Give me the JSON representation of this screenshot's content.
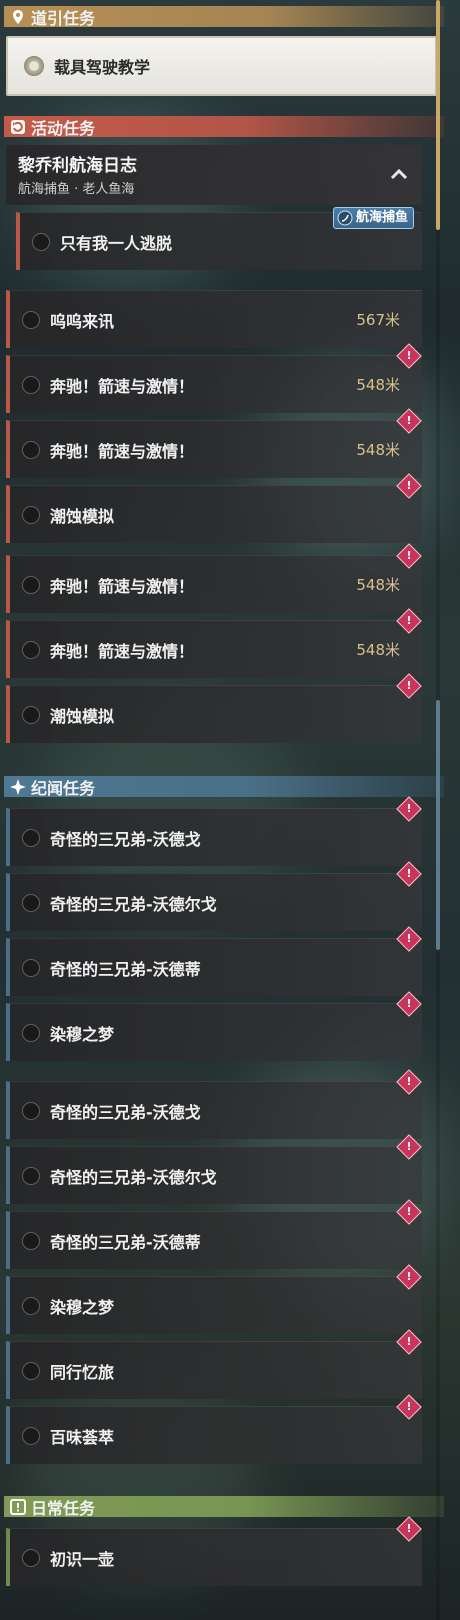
{
  "sections": {
    "guide": {
      "label": "道引任务"
    },
    "event": {
      "label": "活动任务"
    },
    "lore": {
      "label": "纪闻任务"
    },
    "daily": {
      "label": "日常任务"
    }
  },
  "guide_task": {
    "title": "载具驾驶教学"
  },
  "quest_chain": {
    "title": "黎乔利航海日志",
    "subtitle": "航海捕鱼 · 老人鱼海"
  },
  "event_tasks": [
    {
      "title": "只有我一人逃脱",
      "tag": "航海捕鱼"
    },
    {
      "title": "呜呜来讯",
      "distance": "567米"
    },
    {
      "title": "奔驰！箭速与激情！",
      "distance": "548米"
    },
    {
      "title": "奔驰！箭速与激情！",
      "distance": "548米"
    },
    {
      "title": "潮蚀模拟"
    },
    {
      "title": "奔驰！箭速与激情！",
      "distance": "548米"
    },
    {
      "title": "奔驰！箭速与激情！",
      "distance": "548米"
    },
    {
      "title": "潮蚀模拟"
    }
  ],
  "lore_tasks": [
    {
      "title": "奇怪的三兄弟-沃德戈"
    },
    {
      "title": "奇怪的三兄弟-沃德尔戈"
    },
    {
      "title": "奇怪的三兄弟-沃德蒂"
    },
    {
      "title": "染穆之梦"
    },
    {
      "title": "奇怪的三兄弟-沃德戈"
    },
    {
      "title": "奇怪的三兄弟-沃德尔戈"
    },
    {
      "title": "奇怪的三兄弟-沃德蒂"
    },
    {
      "title": "染穆之梦"
    },
    {
      "title": "同行忆旅"
    },
    {
      "title": "百味荟萃"
    }
  ],
  "daily_tasks": [
    {
      "title": "初识一壶"
    }
  ],
  "colors": {
    "guide": "#b78f55",
    "event": "#c65a4a",
    "lore": "#4f7892",
    "daily": "#7f9b55",
    "distance": "#d9c18f",
    "alert": "#c9355a"
  },
  "icons": {
    "guide": "map-pin-icon",
    "event": "refresh-icon",
    "lore": "sparkle-icon",
    "daily": "exclaim-box-icon",
    "alert": "alert-diamond-icon",
    "collapse": "chevron-up-icon",
    "tag": "fishing-icon"
  }
}
